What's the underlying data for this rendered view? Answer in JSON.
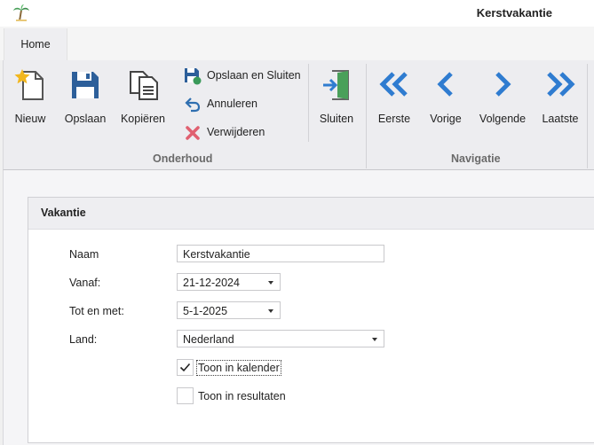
{
  "window": {
    "title": "Kerstvakantie",
    "app_icon": "palm-tree-icon"
  },
  "tabs": [
    {
      "label": "Home",
      "active": true
    }
  ],
  "ribbon": {
    "groups": {
      "onderhoud": "Onderhoud",
      "navigatie": "Navigatie"
    },
    "buttons": {
      "nieuw": "Nieuw",
      "opslaan": "Opslaan",
      "kopieren": "Kopiëren",
      "opslaan_sluiten": "Opslaan en Sluiten",
      "annuleren": "Annuleren",
      "verwijderen": "Verwijderen",
      "sluiten": "Sluiten",
      "eerste": "Eerste",
      "vorige": "Vorige",
      "volgende": "Volgende",
      "laatste": "Laatste"
    }
  },
  "form": {
    "section_title": "Vakantie",
    "naam": {
      "label": "Naam",
      "value": "Kerstvakantie"
    },
    "vanaf": {
      "label": "Vanaf:",
      "value": "21-12-2024"
    },
    "tot_en_met": {
      "label": "Tot en met:",
      "value": "5-1-2025"
    },
    "land": {
      "label": "Land:",
      "value": "Nederland"
    },
    "toon_in_kalender": {
      "label": "Toon in kalender",
      "checked": true
    },
    "toon_in_resultaten": {
      "label": "Toon in resultaten",
      "checked": false
    }
  },
  "colors": {
    "nav_blue": "#2f7cd0",
    "save_blue": "#2d5f9a",
    "delete_red": "#e06070",
    "accent_yellow": "#f2b71e"
  }
}
